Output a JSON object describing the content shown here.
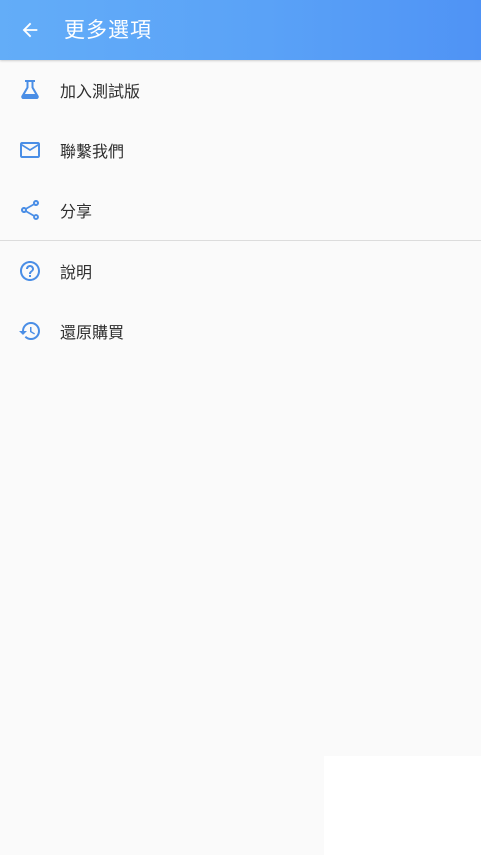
{
  "toolbar": {
    "title": "更多選項",
    "back_icon": "arrow-left-icon",
    "colors": {
      "start": "#63adf8",
      "end": "#4f93f5"
    }
  },
  "menu": {
    "items": [
      {
        "label": "加入測試版",
        "icon": "flask-icon"
      },
      {
        "label": "聯繫我們",
        "icon": "mail-icon"
      },
      {
        "label": "分享",
        "icon": "share-icon"
      },
      {
        "label": "說明",
        "icon": "help-circle-icon"
      },
      {
        "label": "還原購買",
        "icon": "restore-history-icon"
      }
    ]
  },
  "colors": {
    "icon": "#4a8ee6",
    "text": "#2f2f2f",
    "background": "#fafafa",
    "divider": "#dcdcdc"
  }
}
